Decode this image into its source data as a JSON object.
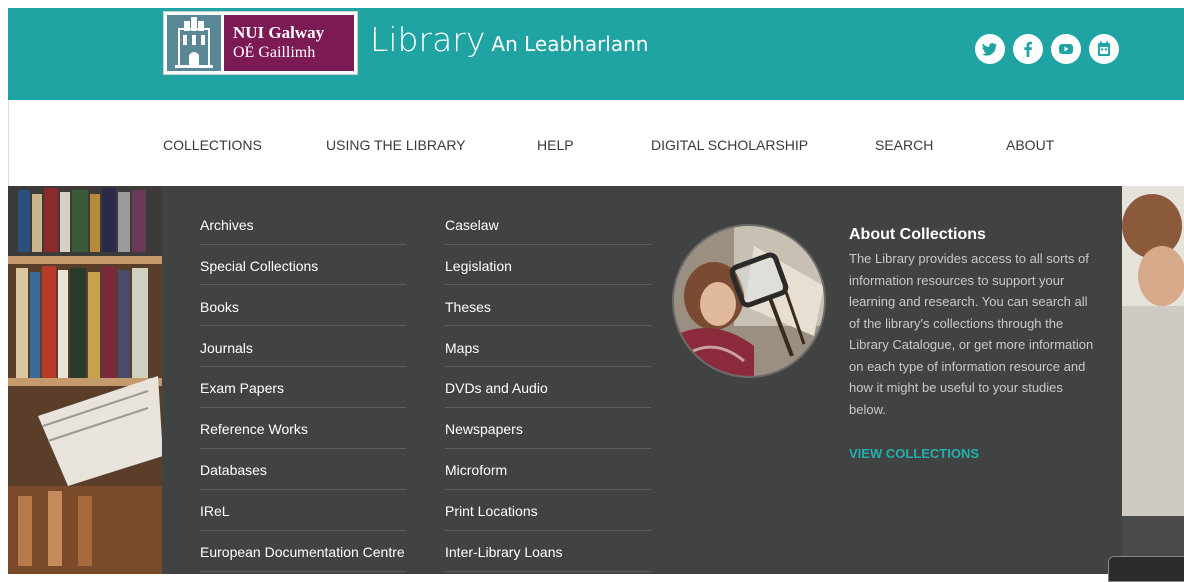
{
  "header": {
    "logo_line1": "NUI Galway",
    "logo_line2": "OÉ Gaillimh",
    "title_main": "Library",
    "title_sub": "An Leabharlann",
    "social_icons": [
      "twitter-icon",
      "facebook-icon",
      "youtube-icon",
      "calendar-icon"
    ],
    "colors": {
      "header_bg": "#1fa4a3",
      "logo_bg": "#7b1a55"
    }
  },
  "nav": {
    "items": [
      {
        "label": "COLLECTIONS",
        "active": true
      },
      {
        "label": "USING THE LIBRARY"
      },
      {
        "label": "HELP"
      },
      {
        "label": "DIGITAL SCHOLARSHIP"
      },
      {
        "label": "SEARCH"
      },
      {
        "label": "ABOUT"
      }
    ]
  },
  "dropdown": {
    "col1": [
      "Archives",
      "Special Collections",
      "Books",
      "Journals",
      "Exam Papers",
      "Reference Works",
      "Databases",
      "IReL",
      "European Documentation Centre"
    ],
    "col2": [
      "Caselaw",
      "Legislation",
      "Theses",
      "Maps",
      "DVDs and Audio",
      "Newspapers",
      "Microform",
      "Print Locations",
      "Inter-Library Loans"
    ],
    "about": {
      "title": "About Collections",
      "text": "The Library provides access to all sorts of information resources to support your learning and research. You can search all of the library's collections through the Library Catalogue, or get more information on each type of information resource and how it might be useful to your studies below.",
      "link": "VIEW COLLECTIONS"
    },
    "colors": {
      "panel_bg": "#414242",
      "accent": "#20b0ad"
    }
  }
}
